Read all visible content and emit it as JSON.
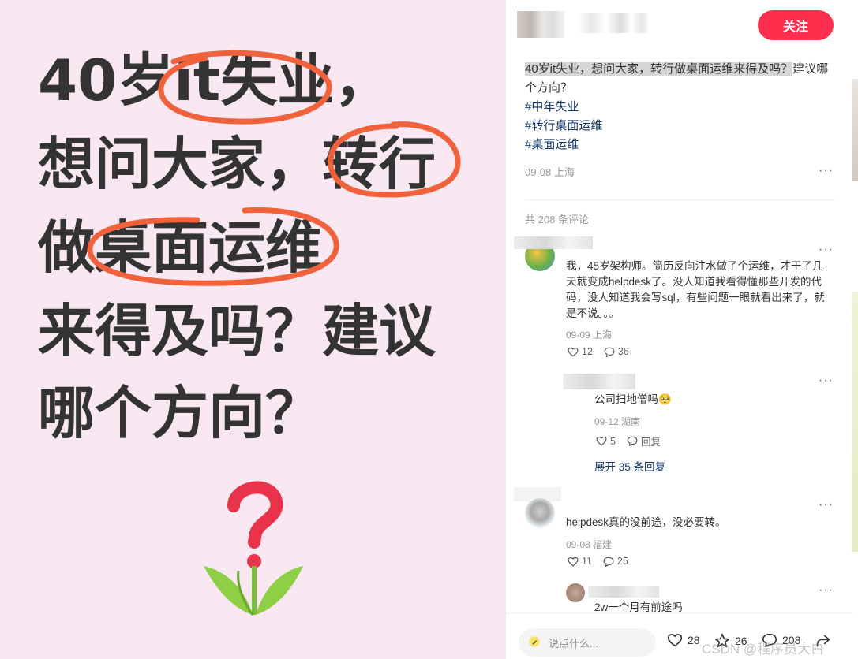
{
  "poster": {
    "line1": "40岁it失业，",
    "line2": "想问大家，转行",
    "line3": "做桌面运维",
    "line4": "来得及吗？建议",
    "line5": "哪个方向？"
  },
  "header": {
    "follow_label": "关注"
  },
  "post": {
    "title_highlight": "40岁it失业，想问大家，转行做桌面运维来得及吗？",
    "title_rest": "建议哪个方向？",
    "hashtags": [
      "#中年失业",
      "#转行桌面运维",
      "#桌面运维"
    ],
    "date_location": "09-08 上海"
  },
  "comments_header": {
    "count_label": "共 208 条评论"
  },
  "comments": [
    {
      "text": "我，45岁架构师。简历反向注水做了个运维，才干了几天就变成helpdesk了。没人知道我看得懂那些开发的代码，没人知道我会写sql，有些问题一眼就看出来了，就是不说。。。",
      "date_location": "09-09 上海",
      "likes": "12",
      "replies": "36",
      "reply": {
        "text": "公司扫地僧吗🥺",
        "date_location": "09-12 湖南",
        "likes": "5",
        "reply_label": "回复"
      },
      "expand_label": "展开 35 条回复"
    },
    {
      "text": "helpdesk真的没前途，没必要转。",
      "date_location": "09-08 福建",
      "likes": "11",
      "replies": "25",
      "reply": {
        "text": "2w一个月有前途吗"
      }
    }
  ],
  "bottom_bar": {
    "input_placeholder": "说点什么...",
    "likes": "28",
    "stars": "26",
    "comments": "208"
  },
  "watermark": "CSDN @程序员大白",
  "colors": {
    "accent": "#ff2e4d",
    "hashtag": "#13386c",
    "poster_bg": "#f9e7f1",
    "ring": "#f0623b"
  }
}
